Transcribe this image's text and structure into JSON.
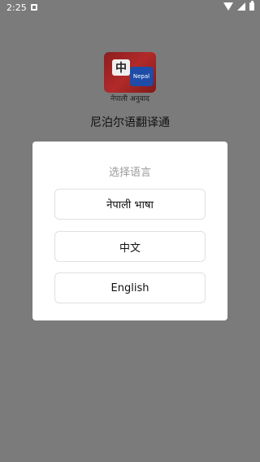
{
  "statusbar": {
    "time": "2:25",
    "icons": [
      "notification-icon",
      "wifi-icon",
      "signal-icon",
      "battery-icon"
    ]
  },
  "app": {
    "icon_glyph": "中",
    "icon_badge": "Nepal",
    "icon_caption": "नेपाली अनुवाद",
    "title": "尼泊尔语翻译通"
  },
  "dialog": {
    "title": "选择语言",
    "options": [
      "नेपाली भाषा",
      "中文",
      "English"
    ]
  },
  "colors": {
    "background": "#7b7b7b",
    "dialog": "#ffffff",
    "icon_red": "#b22a2a",
    "icon_blue": "#1f4ca8"
  }
}
